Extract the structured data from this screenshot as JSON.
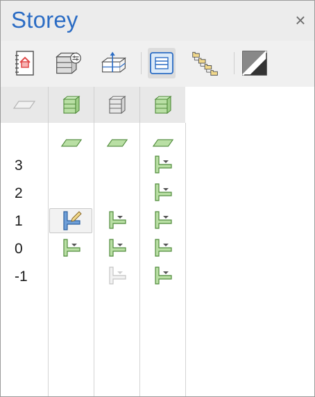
{
  "panel": {
    "title": "Storey",
    "close_glyph": "×"
  },
  "toolbar": {
    "buttons": [
      {
        "icon": "storey-document-icon"
      },
      {
        "icon": "storey-settings-icon"
      },
      {
        "icon": "storey-elevation-icon"
      },
      {
        "icon": "list-view-icon",
        "active": true
      },
      {
        "icon": "hierarchy-view-icon"
      },
      {
        "icon": "contrast-toggle-icon"
      }
    ]
  },
  "columns": [
    {
      "icon": "slab-icon"
    },
    {
      "icon": "green-building-icon"
    },
    {
      "icon": "gray-building-icon"
    },
    {
      "icon": "green-building-icon"
    }
  ],
  "storey_labels": [
    "3",
    "2",
    "1",
    "0",
    "-1"
  ],
  "colors": {
    "title": "#2b6cc4",
    "green_fill": "#b9dfa4",
    "green_stroke": "#4f8a3a",
    "blue_fill": "#6f9fd8",
    "gray_fill": "#e6e6e6"
  }
}
